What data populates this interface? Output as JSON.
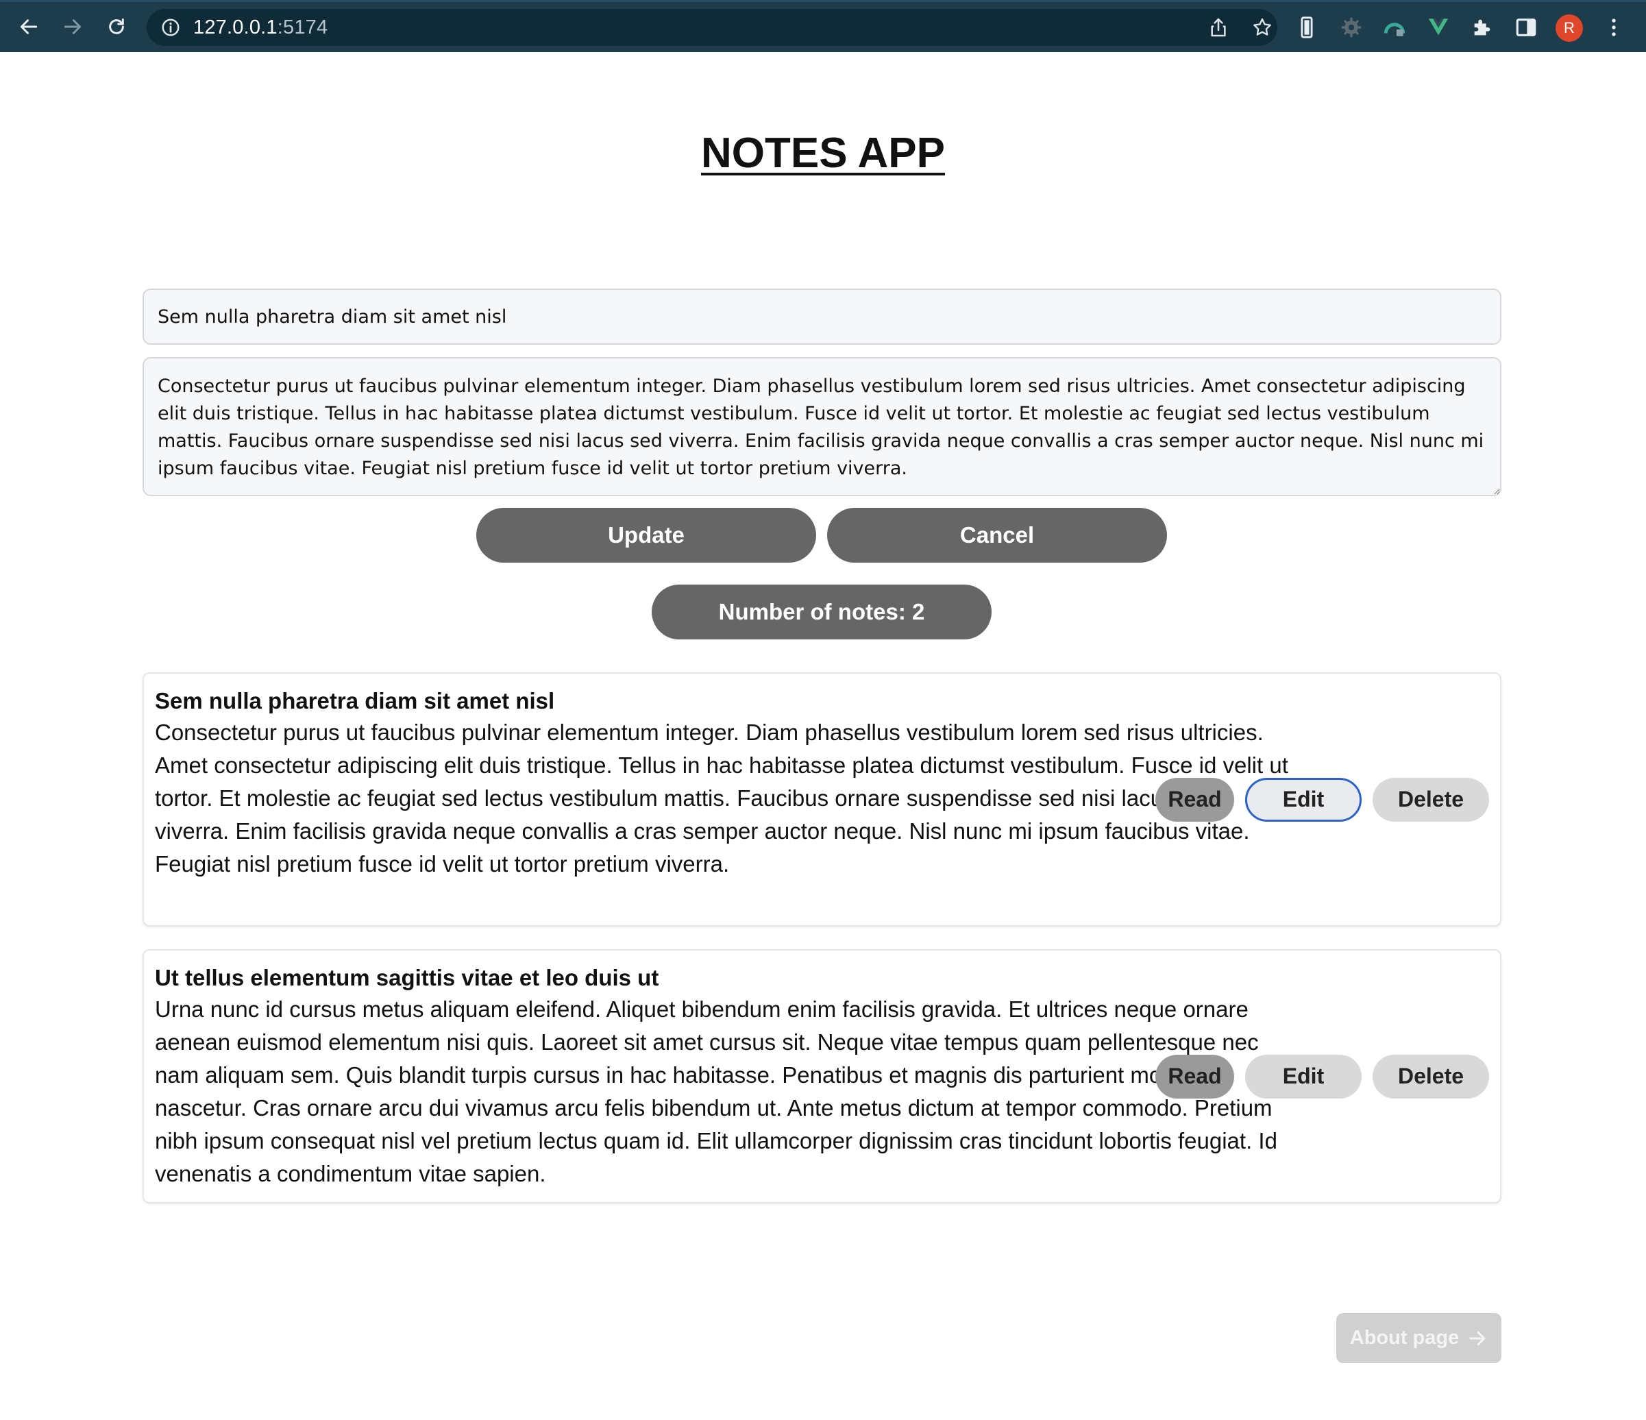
{
  "browser": {
    "url_host": "127.0.0.1",
    "url_port": ":5174",
    "profile_initial": "R",
    "icons": [
      "back-icon",
      "forward-icon",
      "reload-icon",
      "info-icon",
      "share-icon",
      "star-icon",
      "phone-icon",
      "gear-extension-icon",
      "extension-icon",
      "vue-devtools-icon",
      "puzzle-icon",
      "side-panel-icon",
      "menu-kebab-icon"
    ]
  },
  "app": {
    "title": "NOTES APP"
  },
  "form": {
    "title_value": "Sem nulla pharetra diam sit amet nisl",
    "body_value": "Consectetur purus ut faucibus pulvinar elementum integer. Diam phasellus vestibulum lorem sed risus ultricies. Amet consectetur adipiscing elit duis tristique. Tellus in hac habitasse platea dictumst vestibulum. Fusce id velit ut tortor. Et molestie ac feugiat sed lectus vestibulum mattis. Faucibus ornare suspendisse sed nisi lacus sed viverra. Enim facilisis gravida neque convallis a cras semper auctor neque. Nisl nunc mi ipsum faucibus vitae. Feugiat nisl pretium fusce id velit ut tortor pretium viverra.",
    "update_label": "Update",
    "cancel_label": "Cancel"
  },
  "count": {
    "label": "Number of notes: 2"
  },
  "notes": [
    {
      "title": "Sem nulla pharetra diam sit amet nisl",
      "body": "Consectetur purus ut faucibus pulvinar elementum integer. Diam phasellus vestibulum lorem sed risus ultricies. Amet consectetur adipiscing elit duis tristique. Tellus in hac habitasse platea dictumst vestibulum. Fusce id velit ut tortor. Et molestie ac feugiat sed lectus vestibulum mattis. Faucibus ornare suspendisse sed nisi lacus sed viverra. Enim facilisis gravida neque convallis a cras semper auctor neque. Nisl nunc mi ipsum faucibus vitae. Feugiat nisl pretium fusce id velit ut tortor pretium viverra.",
      "read_label": "Read",
      "edit_label": "Edit",
      "delete_label": "Delete"
    },
    {
      "title": "Ut tellus elementum sagittis vitae et leo duis ut",
      "body": "Urna nunc id cursus metus aliquam eleifend. Aliquet bibendum enim facilisis gravida. Et ultrices neque ornare aenean euismod elementum nisi quis. Laoreet sit amet cursus sit. Neque vitae tempus quam pellentesque nec nam aliquam sem. Quis blandit turpis cursus in hac habitasse. Penatibus et magnis dis parturient montes nascetur. Cras ornare arcu dui vivamus arcu felis bibendum ut. Ante metus dictum at tempor commodo. Pretium nibh ipsum consequat nisl vel pretium lectus quam id. Elit ullamcorper dignissim cras tincidunt lobortis feugiat. Id venenatis a condimentum vitae sapien.",
      "read_label": "Read",
      "edit_label": "Edit",
      "delete_label": "Delete"
    }
  ],
  "footer": {
    "about_label": "About page"
  },
  "colors": {
    "chrome_bg": "#1d3c4c",
    "pill_bg": "#666666",
    "focus_ring": "#2d63c8",
    "avatar_bg": "#e0462a"
  }
}
